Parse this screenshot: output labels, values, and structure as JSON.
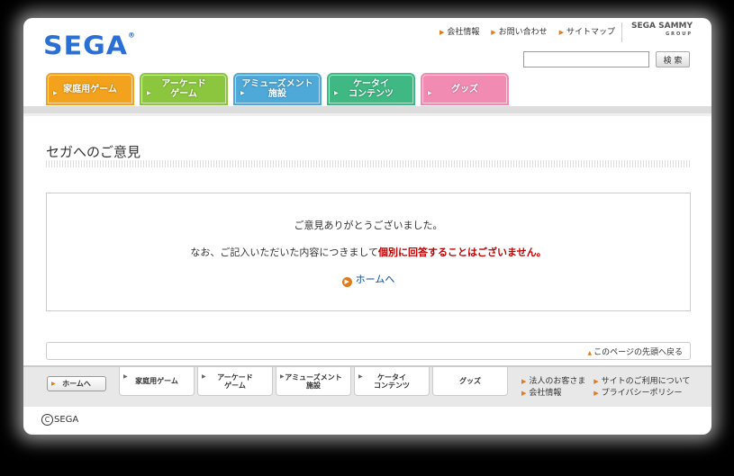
{
  "header": {
    "logo": "SEGA",
    "logo_mark": "®",
    "top_links": [
      "会社情報",
      "お問い合わせ",
      "サイトマップ"
    ],
    "group_logo": "SEGA SAMMY",
    "group_sub": "GROUP",
    "search": {
      "value": "",
      "button": "検 索"
    }
  },
  "tabs": [
    {
      "line1": "家庭用ゲーム",
      "line2": "",
      "color": "#f2a21c"
    },
    {
      "line1": "アーケード",
      "line2": "ゲーム",
      "color": "#8cc63f"
    },
    {
      "line1": "アミューズメント",
      "line2": "施設",
      "color": "#4ea8d8"
    },
    {
      "line1": "ケータイ",
      "line2": "コンテンツ",
      "color": "#3fb883"
    },
    {
      "line1": "グッズ",
      "line2": "",
      "color": "#f28bb2"
    }
  ],
  "page": {
    "title": "セガへのご意見",
    "message1": "ご意見ありがとうございました。",
    "message2_prefix": "なお、ご記入いただいた内容につきまして",
    "message2_emphasis": "個別に回答することはございません。",
    "home_link": "ホームへ",
    "page_top": "このページの先頭へ戻る"
  },
  "footer": {
    "home_button": "ホームへ",
    "tabs": [
      {
        "line1": "家庭用ゲーム",
        "line2": ""
      },
      {
        "line1": "アーケード",
        "line2": "ゲーム"
      },
      {
        "line1": "アミューズメント",
        "line2": "施設"
      },
      {
        "line1": "ケータイ",
        "line2": "コンテンツ"
      },
      {
        "line1": "グッズ",
        "line2": ""
      }
    ],
    "links_col1": [
      "法人のお客さま",
      "会社情報"
    ],
    "links_col2": [
      "サイトのご利用について",
      "プライバシーポリシー"
    ],
    "copyright": "SEGA",
    "copyright_mark": "C"
  }
}
